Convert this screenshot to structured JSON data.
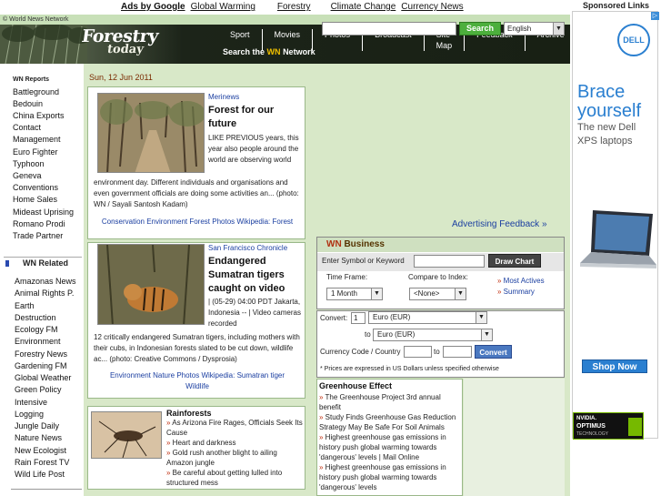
{
  "top_ads": {
    "ads_by": "Ads by Google",
    "links": [
      "Global Warming",
      "Forestry",
      "Climate Change",
      "Currency News"
    ]
  },
  "wn_bar": "© World News Network",
  "logo": {
    "line1": "Forestry",
    "line2": "today"
  },
  "nav": [
    "Sport",
    "Movies",
    "Photos",
    "Broadcast",
    "Site Map",
    "Feedback",
    "Archive"
  ],
  "search": {
    "label_prefix": "Search the",
    "label_wn": "WN",
    "label_suffix": "Network",
    "button": "Search",
    "language": "English"
  },
  "sidebar": {
    "reports_heading": "WN Reports",
    "reports": [
      "Battleground",
      "Bedouin",
      "China Exports",
      "Contact",
      "Management",
      "Euro Fighter",
      "Typhoon",
      "Geneva",
      "Conventions",
      "Home Sales",
      "Mideast Uprising",
      "Romano Prodi",
      "Trade Partner"
    ],
    "related_heading": "WN Related",
    "related": [
      "Amazonas News",
      "Animal Rights P.",
      "Earth",
      "Destruction",
      "Ecology FM",
      "Environment",
      "Forestry News",
      "Gardening FM",
      "Global Weather",
      "Green Policy",
      "Intensive",
      "Logging",
      "Jungle Daily",
      "Nature News",
      "New Ecologist",
      "Rain Forest TV",
      "Wild Life Post"
    ]
  },
  "date": "Sun, 12 Jun 2011",
  "stories": [
    {
      "source": "Merinews",
      "title": "Forest for our future",
      "body_side": "LIKE PREVIOUS years, this year also people around the world are observing world",
      "body_full": "environment day. Different individuals and organisations and even government officials are doing some activities an... (photo: WN / Sayali Santosh Kadam)",
      "tags": "Conservation  Environment  Forest  Photos  Wikipedia: Forest"
    },
    {
      "source": "San Francisco Chronicle",
      "title": "Endangered Sumatran tigers caught on video",
      "body_side": "| (05-29) 04:00 PDT Jakarta, Indonesia -- | Video cameras recorded",
      "body_full": "12 critically endangered Sumatran tigers, including mothers with their cubs, in Indonesian forests slated to be cut down, wildlife ac... (photo: Creative Commons / Dysprosia)",
      "tags": "Environment  Nature  Photos  Wikipedia: Sumatran tiger Wildlife"
    },
    {
      "title": "Rainforests",
      "items": [
        "As Arizona Fire Rages, Officials Seek Its Cause",
        "Heart and darkness",
        "Gold rush another blight to ailing Amazon jungle",
        "Be careful about getting lulled into structured mess"
      ]
    }
  ],
  "advertising_feedback": "Advertising Feedback »",
  "business": {
    "header_wn": "WN",
    "header_title": "Business",
    "symbol_label": "Enter Symbol or Keyword",
    "draw_chart": "Draw Chart",
    "time_frame_label": "Time Frame:",
    "time_frame_value": "1 Month",
    "compare_label": "Compare to Index:",
    "compare_value": "<None>",
    "most_actives": "Most Actives",
    "summary": "Summary"
  },
  "converter": {
    "convert_label": "Convert:",
    "amount": "1",
    "from": "Euro (EUR)",
    "to_label": "to",
    "to": "Euro (EUR)",
    "code_label": "Currency Code / Country",
    "code_to": "to",
    "button": "Convert",
    "note": "* Prices are expressed in US Dollars unless specified otherwise"
  },
  "greenhouse": {
    "title": "Greenhouse Effect",
    "items": [
      "The Greenhouse Project 3rd annual benefit",
      "Study Finds Greenhouse Gas Reduction Strategy May Be Safe For Soil Animals",
      "Highest greenhouse gas emissions in history push global warming towards 'dangerous' levels | Mail Online",
      "Highest greenhouse gas emissions in history push global warming towards 'dangerous' levels"
    ]
  },
  "sponsored": {
    "heading": "Sponsored Links",
    "brand": "DELL",
    "headline1": "Brace",
    "headline2": "yourself",
    "sub": "The new Dell XPS laptops",
    "cta": "Shop Now",
    "badge1": "NVIDIA.",
    "badge2": "OPTIMUS",
    "badge3": "TECHNOLOGY"
  },
  "colors": {
    "header_bg": "#1c2419",
    "page_bg": "#d8e8c8",
    "search_green": "#4caf3c",
    "link_blue": "#1a3ea0",
    "dell_blue": "#2a7fd0"
  }
}
